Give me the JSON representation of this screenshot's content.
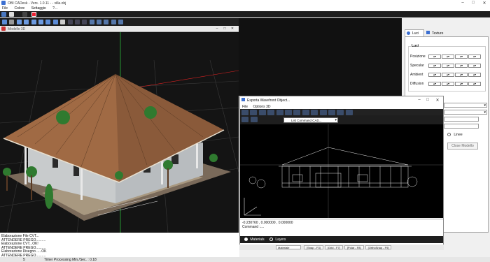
{
  "app": {
    "title": "OBI CADesk - Vers. 1.0.11 - - villa.obj"
  },
  "menu": [
    "File",
    "Colore",
    "Settaggio",
    "?..."
  ],
  "model_window": {
    "title": "Modello 3D"
  },
  "lights_panel": {
    "tabs": [
      "Luci",
      "Texture"
    ],
    "group_title": "Luci",
    "rows": [
      {
        "label": "Posizione"
      },
      {
        "label": "Specular"
      },
      {
        "label": "Ambient"
      },
      {
        "label": "Diffusion"
      }
    ],
    "radio_label": "Linee",
    "close_button": "Close Modello"
  },
  "export_window": {
    "title": "Esporta Wavefront Object...",
    "menu": [
      "File",
      "Options 3D"
    ],
    "dropdown_value": "List Command CAD...",
    "coords": "-0.230760 , 0.000000 , 0.000000",
    "command": "Command :....",
    "tabs": [
      "Materials",
      "Layers"
    ],
    "status": {
      "field": "Materiale",
      "buttons": [
        "[Snap - F3]",
        "[Grid - F7]",
        "[Polar - F8]",
        "[OrthoSnap - F9]"
      ]
    }
  },
  "log": [
    "Elaborazione File CVT...",
    "ATTENDERE PREGO..........",
    "Elaborazione CVT...OK!",
    "ATTENDERE PREGO..........",
    "Elaborazione Disegno .....OK",
    "ATTENDERE PREGO.........."
  ],
  "statusbar": {
    "count": "5",
    "timer": "Timer Processing Min./Sec. : 0.18"
  },
  "colors": {
    "dark_bg": "#1b1b1b",
    "roof": "#8a5a3a",
    "wire": "#e8e8e8",
    "accent": "#2a66c8"
  }
}
